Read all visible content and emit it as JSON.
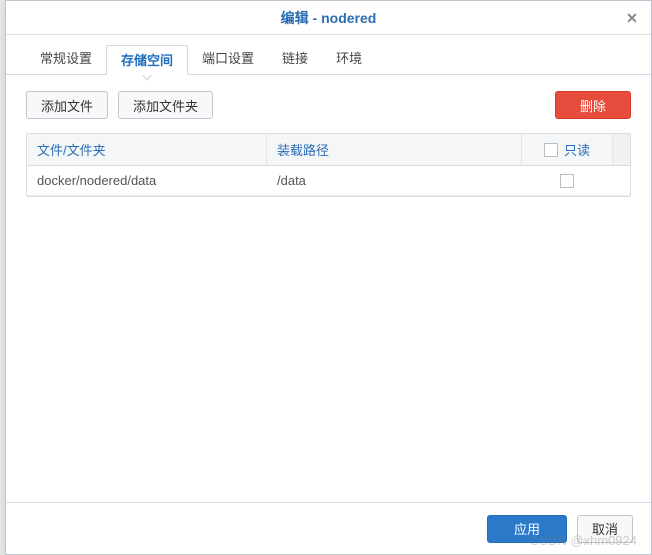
{
  "title": "编辑 - nodered",
  "tabs": [
    {
      "label": "常规设置",
      "active": false
    },
    {
      "label": "存储空间",
      "active": true
    },
    {
      "label": "端口设置",
      "active": false
    },
    {
      "label": "链接",
      "active": false
    },
    {
      "label": "环境",
      "active": false
    }
  ],
  "toolbar": {
    "add_file": "添加文件",
    "add_folder": "添加文件夹",
    "delete": "删除"
  },
  "table": {
    "headers": {
      "path": "文件/文件夹",
      "mount": "装载路径",
      "readonly": "只读"
    },
    "rows": [
      {
        "path": "docker/nodered/data",
        "mount": "/data",
        "readonly": false
      }
    ]
  },
  "footer": {
    "apply": "应用",
    "cancel": "取消"
  },
  "watermark": "CSDN @xhm0924"
}
